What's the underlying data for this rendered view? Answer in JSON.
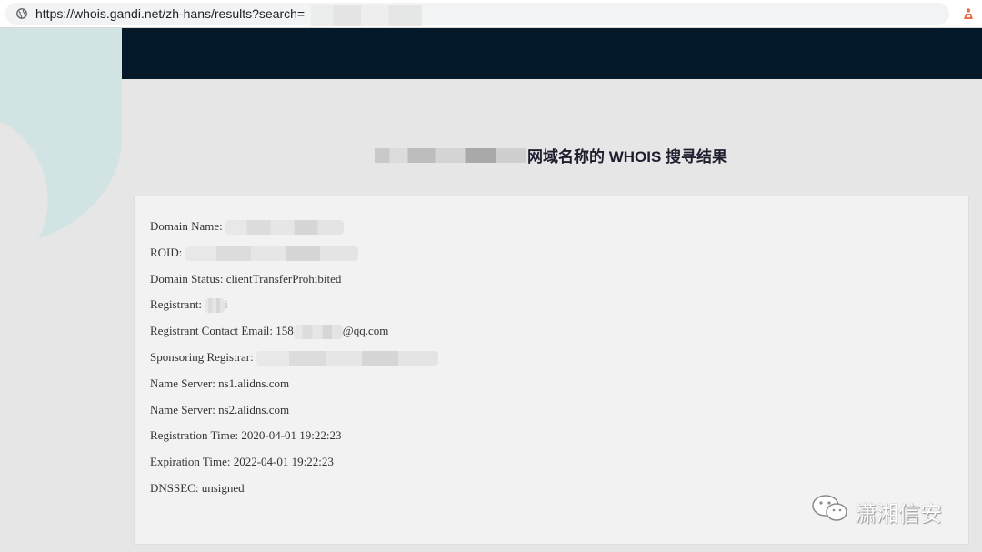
{
  "browser": {
    "url": "https://whois.gandi.net/zh-hans/results?search="
  },
  "heading": {
    "title": "网域名称的 WHOIS 搜寻结果"
  },
  "whois": {
    "domain_name_label": "Domain Name:",
    "roid_label": "ROID:",
    "domain_status": "Domain Status: clientTransferProhibited",
    "registrant_label": "Registrant:",
    "registrant_suffix": "i",
    "email_label": "Registrant Contact Email:",
    "email_prefix": "158",
    "email_suffix": "@qq.com",
    "registrar_label": "Sponsoring Registrar:",
    "name_server_1": "Name Server: ns1.alidns.com",
    "name_server_2": "Name Server: ns2.alidns.com",
    "registration_time": "Registration Time: 2020-04-01 19:22:23",
    "expiration_time": "Expiration Time: 2022-04-01 19:22:23",
    "dnssec": "DNSSEC: unsigned"
  },
  "watermark": {
    "text": "潇湘信安"
  },
  "colors": {
    "header_bg": "#031929",
    "page_bg": "#e6e6e6",
    "card_bg": "#f2f2f2",
    "accent_arc": "#d1e3e3"
  }
}
